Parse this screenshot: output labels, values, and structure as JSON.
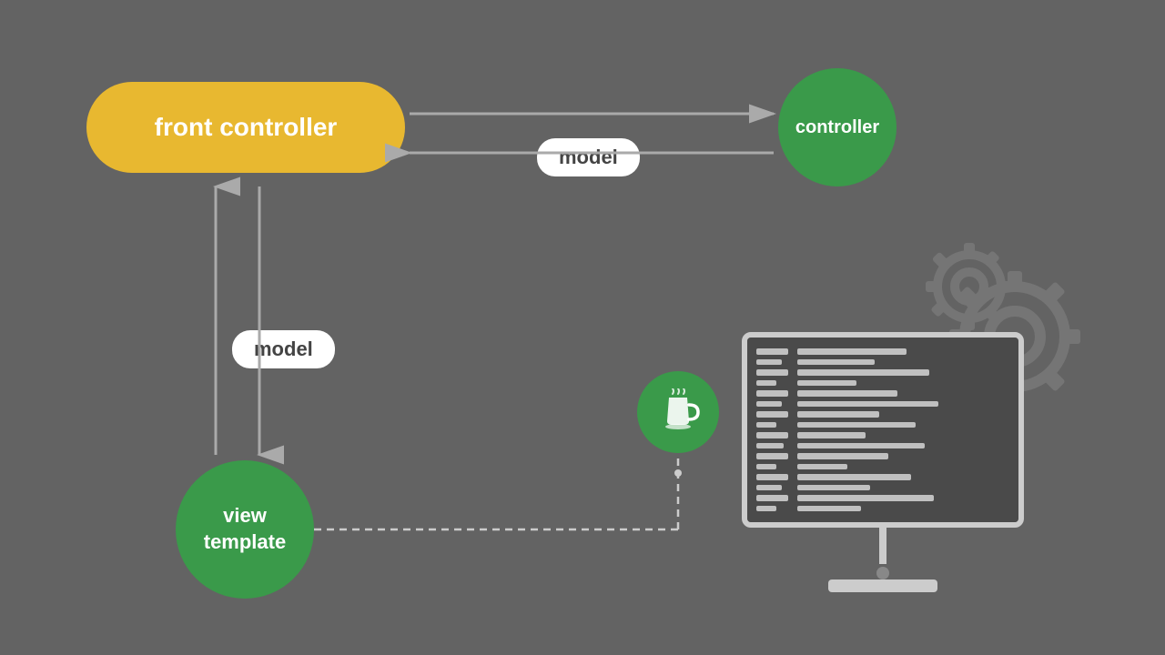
{
  "diagram": {
    "background_color": "#636363",
    "front_controller": {
      "label": "front controller",
      "color": "#E8B830"
    },
    "controller": {
      "label": "controller",
      "color": "#3A9A4A"
    },
    "view_template": {
      "label": "view\ntemplate",
      "color": "#3A9A4A"
    },
    "model_badge_horizontal": {
      "label": "model"
    },
    "model_badge_vertical": {
      "label": "model"
    },
    "java_icon": "☕",
    "gear_color": "#888"
  }
}
